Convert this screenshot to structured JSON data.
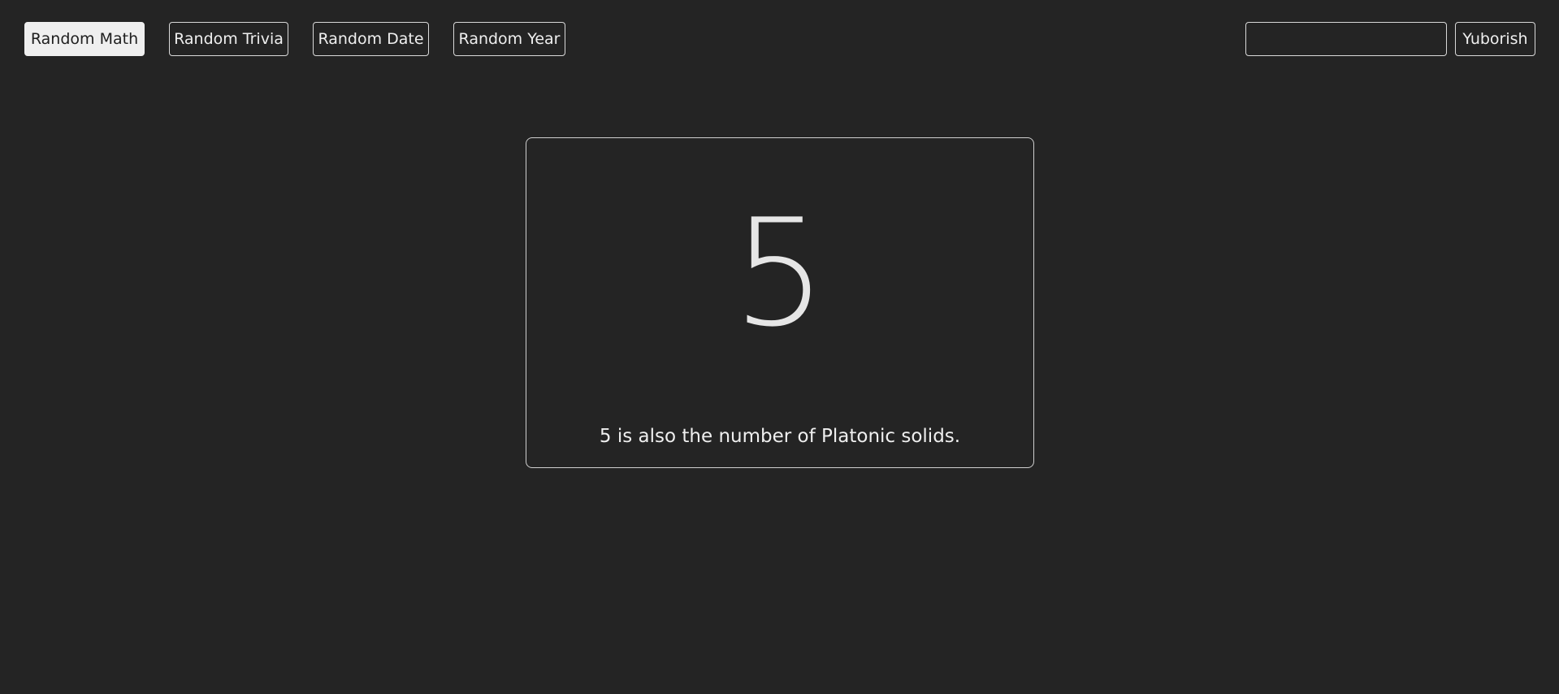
{
  "nav": {
    "math_label": "Random Math",
    "trivia_label": "Random Trivia",
    "date_label": "Random Date",
    "year_label": "Random Year",
    "active": "math"
  },
  "search": {
    "value": "",
    "placeholder": "",
    "submit_label": "Yuborish"
  },
  "result": {
    "number": "5",
    "fact": "5 is also the number of Platonic solids."
  },
  "colors": {
    "background": "#242424",
    "text": "#efefef",
    "border": "#d9d9d9",
    "active_button_bg": "#efefef"
  }
}
